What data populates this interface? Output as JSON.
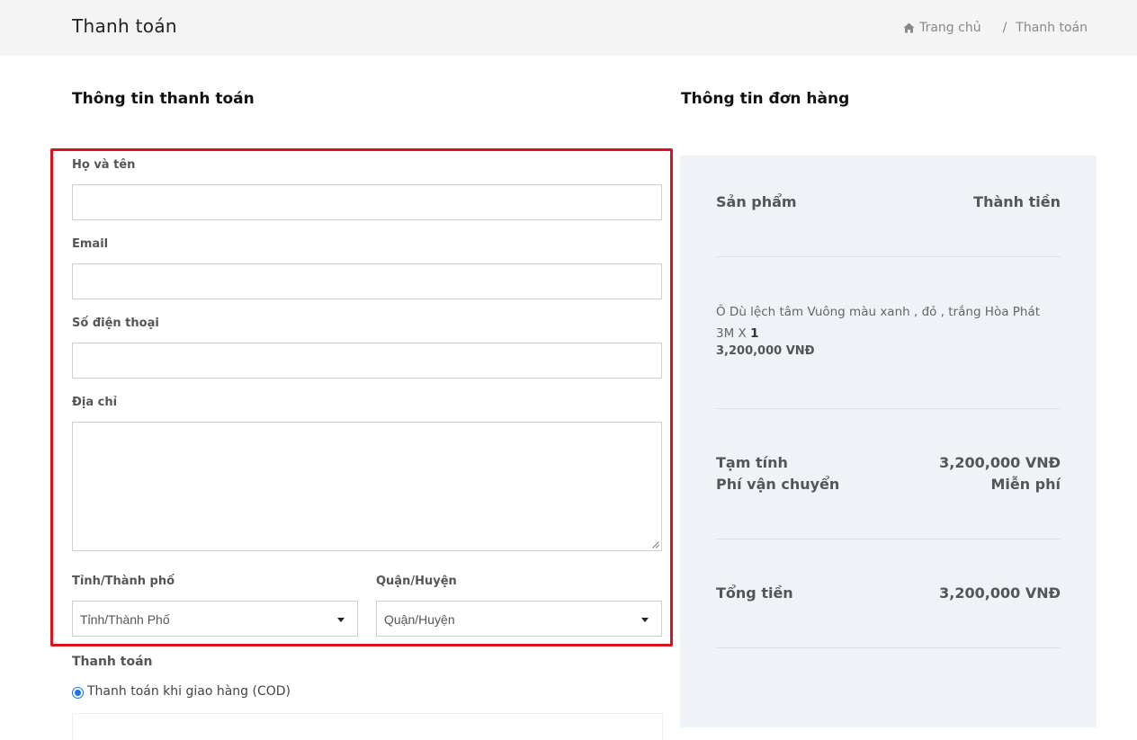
{
  "header": {
    "title": "Thanh toán",
    "breadcrumb": {
      "home": "Trang chủ",
      "separator": "/",
      "current": "Thanh toán"
    }
  },
  "billing": {
    "title": "Thông tin thanh toán",
    "fields": {
      "name_label": "Họ và tên",
      "name_value": "",
      "email_label": "Email",
      "email_value": "",
      "phone_label": "Số điện thoại",
      "phone_value": "",
      "address_label": "Địa chỉ",
      "address_value": "",
      "province_label": "Tỉnh/Thành phố",
      "province_selected": "Tỉnh/Thành Phố",
      "district_label": "Quận/Huyện",
      "district_selected": "Quận/Huyện"
    },
    "payment": {
      "label": "Thanh toán",
      "option_cod": "Thanh toán khi giao hàng (COD)"
    }
  },
  "order": {
    "title": "Thông tin đơn hàng",
    "col_product": "Sản phẩm",
    "col_total": "Thành tiền",
    "item": {
      "name": "Ô Dù lệch tâm Vuông màu xanh , đỏ , trắng Hòa Phát 3M",
      "qty_prefix": "X",
      "qty": "1",
      "price": "3,200,000 VNĐ"
    },
    "subtotal_label": "Tạm tính",
    "subtotal_value": "3,200,000 VNĐ",
    "shipping_label": "Phí vận chuyển",
    "shipping_value": "Miễn phí",
    "total_label": "Tổng tiền",
    "total_value": "3,200,000 VNĐ"
  },
  "colors": {
    "highlight": "#d9141c",
    "panel_bg": "#eff2f6",
    "radio_accent": "#1a73e8"
  }
}
